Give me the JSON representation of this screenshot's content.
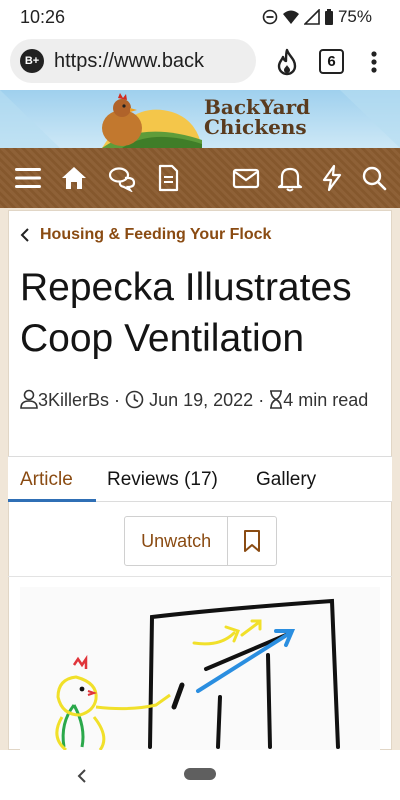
{
  "status": {
    "time": "10:26",
    "battery": "75%"
  },
  "browser": {
    "url": "https://www.back",
    "tab_count": "6",
    "site_badge": "B+"
  },
  "banner": {
    "logo_line1": "BackYard",
    "logo_line2": "Chickens"
  },
  "nav": {
    "icons": [
      "menu-icon",
      "home-icon",
      "chat-icon",
      "document-icon",
      "mail-icon",
      "bell-icon",
      "bolt-icon",
      "search-icon"
    ]
  },
  "article": {
    "breadcrumb": "Housing & Feeding Your Flock",
    "title": "Repecka Illustrates Coop Ventilation",
    "author": "3KillerBs",
    "date": "Jun 19, 2022",
    "read_time": "4 min read",
    "separator": "·"
  },
  "tabs": [
    {
      "label": "Article",
      "active": true
    },
    {
      "label": "Reviews (17)",
      "active": false
    },
    {
      "label": "Gallery",
      "active": false
    }
  ],
  "actions": {
    "unwatch_label": "Unwatch"
  },
  "colors": {
    "accent": "#8a4b12",
    "nav_bg": "#8a5b2f",
    "tab_underline": "#2f6fb5"
  }
}
